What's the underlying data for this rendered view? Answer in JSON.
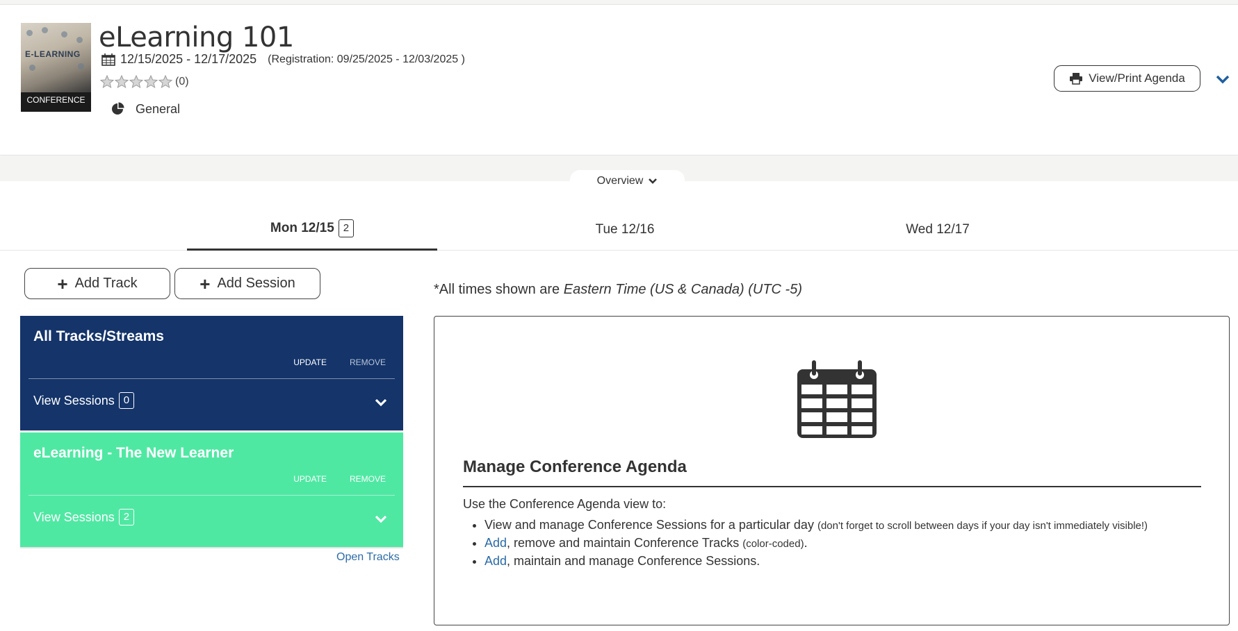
{
  "event": {
    "title": "eLearning 101",
    "dates": "12/15/2025 - 12/17/2025",
    "registration": "(Registration: 09/25/2025  - 12/03/2025 )",
    "rating_count": "(0)",
    "rating_stars": 0,
    "category": "General",
    "thumbnail_label": "CONFERENCE",
    "thumbnail_text": "E-LEARNING"
  },
  "header": {
    "print_label": "View/Print Agenda"
  },
  "overview": {
    "label": "Overview"
  },
  "day_tabs": [
    {
      "label": "Mon 12/15",
      "badge": "2",
      "active": true
    },
    {
      "label": "Tue 12/16",
      "active": false
    },
    {
      "label": "Wed 12/17",
      "active": false
    }
  ],
  "buttons": {
    "add_track": "Add Track",
    "add_session": "Add Session"
  },
  "tracks": [
    {
      "name": "All Tracks/Streams",
      "update": "UPDATE",
      "remove": "REMOVE",
      "view_label": "View Sessions",
      "count": "0",
      "color": "#14346a"
    },
    {
      "name": "eLearning - The New Learner",
      "update": "UPDATE",
      "remove": "REMOVE",
      "view_label": "View Sessions",
      "count": "2",
      "color": "#4fe8a3"
    }
  ],
  "open_tracks": "Open Tracks",
  "timezone": {
    "prefix": "*All times shown are ",
    "zone": "Eastern Time (US & Canada) (UTC -5)"
  },
  "agenda_panel": {
    "heading": "Manage Conference Agenda",
    "intro": "Use the Conference Agenda view to:",
    "item1_text": "View and manage Conference Sessions for a particular day ",
    "item1_note": "(don't forget to scroll between days if your day isn't immediately visible!)",
    "item2_link": "Add",
    "item2_text": ", remove and maintain Conference Tracks ",
    "item2_note": "(color-coded)",
    "item2_end": ".",
    "item3_link": "Add",
    "item3_text": ", maintain and manage Conference Sessions."
  },
  "colors": {
    "accent": "#2c6ba6",
    "navy_track": "#14346a",
    "green_track": "#4fe8a3"
  }
}
